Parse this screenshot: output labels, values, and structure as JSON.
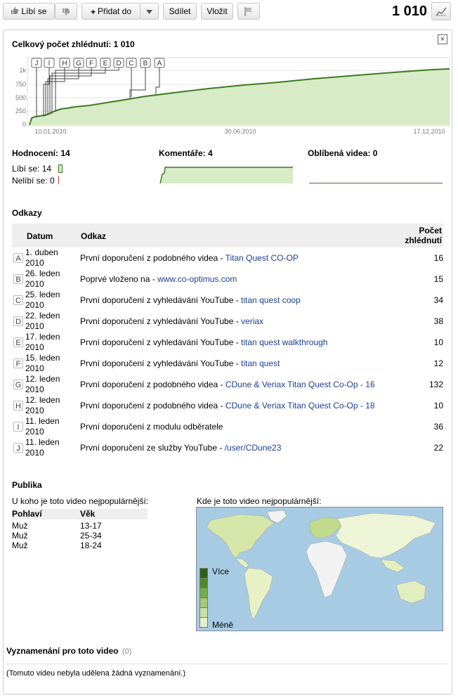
{
  "toolbar": {
    "like_label": "Líbí se",
    "add_to_label": "Přidat do",
    "share_label": "Sdílet",
    "embed_label": "Vložit",
    "view_count": "1 010"
  },
  "stats": {
    "total_views_title": "Celkový počet zhlédnutí: 1 010",
    "close_symbol": "×",
    "markers": [
      "J",
      "I",
      "H",
      "G",
      "F",
      "E",
      "D",
      "C",
      "B",
      "A"
    ],
    "y_ticks": [
      "1k",
      "750",
      "500",
      "250",
      "0"
    ],
    "x_ticks": [
      "10.01.2010",
      "30.06.2010",
      "17.12.2010"
    ],
    "ratings_label": "Hodnocení: 14",
    "likes_label": "Líbí se: 14",
    "dislikes_label": "Nelíbí se: 0",
    "comments_label": "Komentáře: 4",
    "favorites_label": "Oblíbená videa: 0",
    "line_color": "#3b7a1e",
    "fill_color": "#d7ebc6"
  },
  "chart_data": {
    "type": "area",
    "x": [
      "10.01.2010",
      "30.06.2010",
      "17.12.2010"
    ],
    "y_ticks": [
      "0",
      "250",
      "500",
      "750",
      "1k"
    ],
    "ylim": [
      0,
      1000
    ],
    "final_value": 1010
  },
  "referrers": {
    "title": "Odkazy",
    "col_date": "Datum",
    "col_link": "Odkaz",
    "col_count_1": "Počet",
    "col_count_2": "zhlédnutí",
    "rows": [
      {
        "mark": "A",
        "date1": "1. duben",
        "date2": "2010",
        "prefix": "První doporučení z podobného videa - ",
        "link": "Titan Quest CO-OP",
        "count": "16"
      },
      {
        "mark": "B",
        "date1": "26. leden",
        "date2": "2010",
        "prefix": "Poprvé vloženo na - ",
        "link": "www.co-optimus.com",
        "count": "15"
      },
      {
        "mark": "C",
        "date1": "25. leden",
        "date2": "2010",
        "prefix": "První doporučení z vyhledávání YouTube - ",
        "link": "titan quest coop",
        "count": "34"
      },
      {
        "mark": "D",
        "date1": "22. leden",
        "date2": "2010",
        "prefix": "První doporučení z vyhledávání YouTube - ",
        "link": "veriax",
        "count": "38"
      },
      {
        "mark": "E",
        "date1": "17. leden",
        "date2": "2010",
        "prefix": "První doporučení z vyhledávání YouTube - ",
        "link": "titan quest walkthrough",
        "count": "10"
      },
      {
        "mark": "F",
        "date1": "15. leden",
        "date2": "2010",
        "prefix": "První doporučení z vyhledávání YouTube - ",
        "link": "titan quest",
        "count": "12"
      },
      {
        "mark": "G",
        "date1": "12. leden",
        "date2": "2010",
        "prefix": "První doporučení z podobného videa - ",
        "link": "CDune & Veriax Titan Quest Co-Op - 16",
        "count": "132"
      },
      {
        "mark": "H",
        "date1": "12. leden",
        "date2": "2010",
        "prefix": "První doporučení z podobného videa - ",
        "link": "CDune & Veriax Titan Quest Co-Op - 18",
        "count": "10"
      },
      {
        "mark": "I",
        "date1": "11. leden",
        "date2": "2010",
        "prefix": "První doporučení z modulu odběratele",
        "link": "",
        "count": "36"
      },
      {
        "mark": "J",
        "date1": "11. leden",
        "date2": "2010",
        "prefix": "První doporučení ze služby YouTube - ",
        "link": "/user/CDune23",
        "count": "22"
      }
    ]
  },
  "audience": {
    "title": "Publika",
    "who_label": "U koho je toto video nejpopulárnější:",
    "col_gender": "Pohlaví",
    "col_age": "Věk",
    "rows": [
      {
        "gender": "Muž",
        "age": "13-17"
      },
      {
        "gender": "Muž",
        "age": "25-34"
      },
      {
        "gender": "Muž",
        "age": "18-24"
      }
    ],
    "where_label": "Kde je toto video nejpopulárnější:",
    "legend_more": "Více",
    "legend_less": "Méně"
  },
  "honors": {
    "title": "Vyznamenání pro toto video",
    "count": "(0)",
    "empty_text": "(Tomuto videu nebyla udělena žádná vyznamenání.)"
  }
}
